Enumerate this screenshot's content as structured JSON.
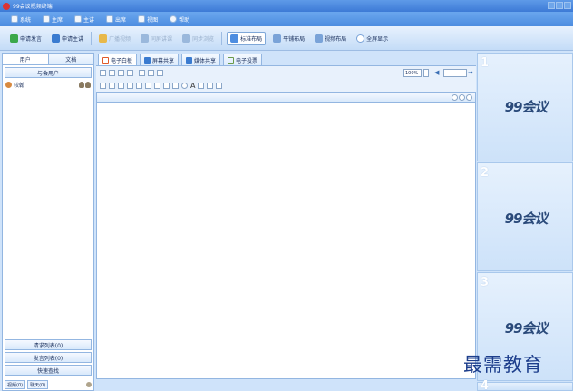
{
  "window": {
    "title": "99会议视频终端"
  },
  "menu": {
    "items": [
      {
        "label": "系统",
        "icon": "gear-icon"
      },
      {
        "label": "主席",
        "icon": "user-icon"
      },
      {
        "label": "主讲",
        "icon": "user-icon"
      },
      {
        "label": "出席",
        "icon": "user-icon"
      },
      {
        "label": "视图",
        "icon": "view-icon"
      },
      {
        "label": "帮助",
        "icon": "help-icon"
      }
    ]
  },
  "toolbar": {
    "apply_chair": "申请发言",
    "apply_speaker": "申请主讲",
    "btn3": "广播视频",
    "btn4": "同屏讲课",
    "btn5": "同步浏览",
    "standard_layout": "标准布局",
    "tile_layout": "平铺布局",
    "video_layout": "视频布局",
    "fullscreen": "全屏显示"
  },
  "left_panel": {
    "tabs": [
      "用户",
      "文档"
    ],
    "header": "与会用户",
    "users": [
      {
        "name": "较翰"
      }
    ],
    "buttons": [
      "请求列表(0)",
      "发言列表(0)",
      "快速查找"
    ],
    "footer_tabs": [
      "视频(0)",
      "聊天(0)"
    ]
  },
  "main": {
    "tabs": [
      {
        "label": "电子白板",
        "icon": "whiteboard-icon",
        "color": "#e05a2a"
      },
      {
        "label": "屏幕共享",
        "icon": "screen-share-icon",
        "color": "#3a7bd0"
      },
      {
        "label": "媒体共享",
        "icon": "media-share-icon",
        "color": "#3a7bd0"
      },
      {
        "label": "电子投票",
        "icon": "vote-icon",
        "color": "#6a9a4a"
      }
    ],
    "zoom": "100%"
  },
  "video_panes": [
    {
      "number": "1",
      "brand": "99会议"
    },
    {
      "number": "2",
      "brand": "99会议"
    },
    {
      "number": "3",
      "brand": "99会议"
    },
    {
      "number": "4",
      "brand": ""
    }
  ],
  "watermark": "最需教育"
}
